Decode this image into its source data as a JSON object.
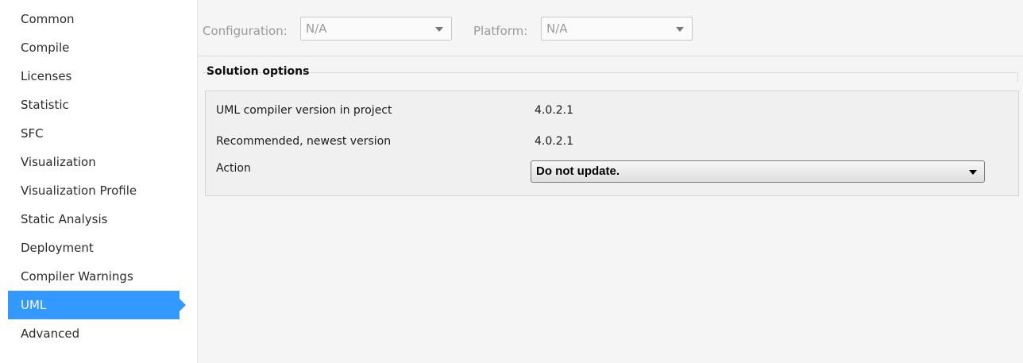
{
  "sidebar": {
    "items": [
      {
        "label": "Common"
      },
      {
        "label": "Compile"
      },
      {
        "label": "Licenses"
      },
      {
        "label": "Statistic"
      },
      {
        "label": "SFC"
      },
      {
        "label": "Visualization"
      },
      {
        "label": "Visualization Profile"
      },
      {
        "label": "Static Analysis"
      },
      {
        "label": "Deployment"
      },
      {
        "label": "Compiler Warnings"
      },
      {
        "label": "UML",
        "selected": true
      },
      {
        "label": "Advanced"
      }
    ],
    "selected_color": "#3399ff"
  },
  "toolbar": {
    "configuration_label": "Configuration:",
    "configuration_value": "N/A",
    "platform_label": "Platform:",
    "platform_value": "N/A"
  },
  "solution_options": {
    "title": "Solution options",
    "rows": [
      {
        "label": "UML compiler version in project",
        "value": "4.0.2.1"
      },
      {
        "label": "Recommended, newest version",
        "value": "4.0.2.1"
      }
    ],
    "action_label": "Action",
    "action_value": "Do not update."
  }
}
